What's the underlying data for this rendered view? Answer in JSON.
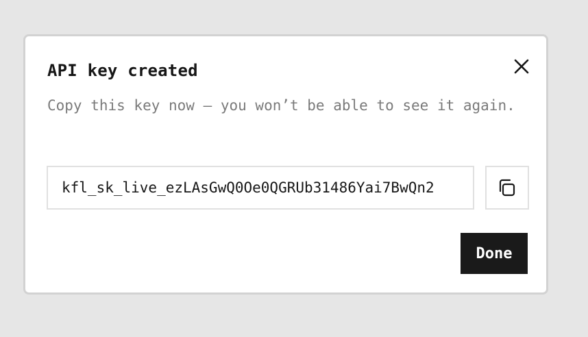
{
  "dialog": {
    "title": "API key created",
    "description": "Copy this key now — you won’t be able to see it again.",
    "key_value": "kfl_sk_live_ezLAsGwQ0Oe0QGRUb31486Yai7BwQn2",
    "close_icon": "close-icon",
    "copy_icon": "copy-icon",
    "done_label": "Done"
  }
}
